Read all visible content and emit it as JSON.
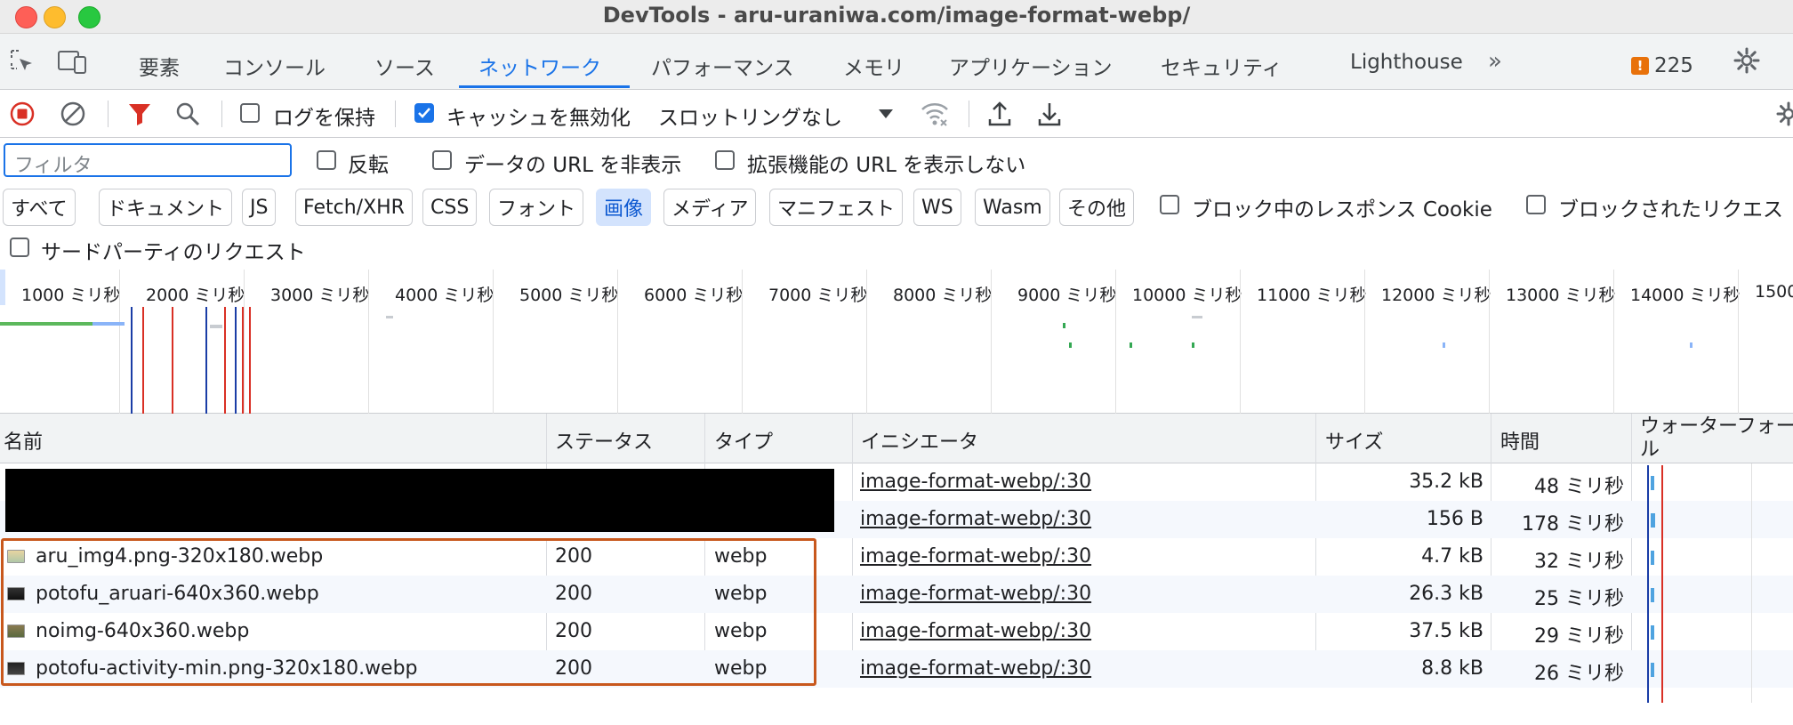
{
  "window": {
    "title": "DevTools - aru-uraniwa.com/image-format-webp/"
  },
  "tabs": [
    "要素",
    "コンソール",
    "ソース",
    "ネットワーク",
    "パフォーマンス",
    "メモリ",
    "アプリケーション",
    "セキュリティ",
    "Lighthouse"
  ],
  "active_tab": "ネットワーク",
  "issues_count": "225",
  "toolbar": {
    "preserve_log": "ログを保持",
    "disable_cache": "キャッシュを無効化",
    "throttling": "スロットリングなし"
  },
  "filter": {
    "placeholder": "フィルタ",
    "invert": "反転",
    "hide_data_urls": "データの URL を非表示",
    "hide_extension_urls": "拡張機能の URL を表示しない",
    "blocked_cookies": "ブロック中のレスポンス Cookie",
    "blocked_requests": "ブロックされたリクエス",
    "third_party": "サードパーティのリクエスト"
  },
  "type_filters": [
    "すべて",
    "ドキュメント",
    "JS",
    "Fetch/XHR",
    "CSS",
    "フォント",
    "画像",
    "メディア",
    "マニフェスト",
    "WS",
    "Wasm",
    "その他"
  ],
  "active_type_filter": "画像",
  "overview_ticks": [
    "1000 ミリ秒",
    "2000 ミリ秒",
    "3000 ミリ秒",
    "4000 ミリ秒",
    "5000 ミリ秒",
    "6000 ミリ秒",
    "7000 ミリ秒",
    "8000 ミリ秒",
    "9000 ミリ秒",
    "10000 ミリ秒",
    "11000 ミリ秒",
    "12000 ミリ秒",
    "13000 ミリ秒",
    "14000 ミリ秒",
    "1500"
  ],
  "columns": {
    "name": "名前",
    "status": "ステータス",
    "type": "タイプ",
    "initiator": "イニシエータ",
    "size": "サイズ",
    "time": "時間",
    "waterfall": "ウォーターフォール"
  },
  "rows": [
    {
      "name": "",
      "status": "",
      "type": "",
      "initiator": "image-format-webp/:30",
      "size": "35.2 kB",
      "time": "48 ミリ秒"
    },
    {
      "name": "",
      "status": "",
      "type": "",
      "initiator": "image-format-webp/:30",
      "size": "156 B",
      "time": "178 ミリ秒"
    },
    {
      "name": "aru_img4.png-320x180.webp",
      "status": "200",
      "type": "webp",
      "initiator": "image-format-webp/:30",
      "size": "4.7 kB",
      "time": "32 ミリ秒"
    },
    {
      "name": "potofu_aruari-640x360.webp",
      "status": "200",
      "type": "webp",
      "initiator": "image-format-webp/:30",
      "size": "26.3 kB",
      "time": "25 ミリ秒"
    },
    {
      "name": "noimg-640x360.webp",
      "status": "200",
      "type": "webp",
      "initiator": "image-format-webp/:30",
      "size": "37.5 kB",
      "time": "29 ミリ秒"
    },
    {
      "name": "potofu-activity-min.png-320x180.webp",
      "status": "200",
      "type": "webp",
      "initiator": "image-format-webp/:30",
      "size": "8.8 kB",
      "time": "26 ミリ秒"
    }
  ],
  "colors": {
    "accent": "#1a73e8",
    "highlight": "#c8581d",
    "record": "#d93025"
  }
}
